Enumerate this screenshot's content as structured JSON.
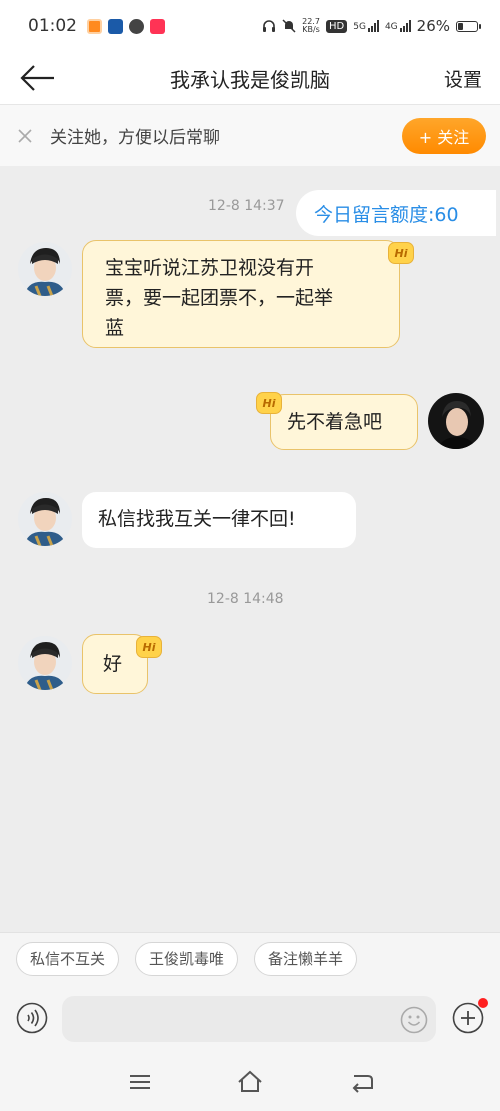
{
  "status_bar": {
    "time": "01:02",
    "net_speed_value": "22.7",
    "net_speed_unit": "KB/s",
    "hd_label": "HD",
    "signal_5g": "5G",
    "signal_4g": "4G",
    "battery_pct": "26%",
    "battery_level": 0.26,
    "icons": [
      "weibo-icon",
      "calendar-icon",
      "link-icon",
      "camera-app-icon",
      "headphones-icon",
      "mute-bell-icon",
      "signal-icon",
      "battery-icon"
    ]
  },
  "header": {
    "title": "我承认我是俊凯脑",
    "settings_label": "设置"
  },
  "follow_bar": {
    "text": "关注她，方便以后常聊",
    "button_label": "+ 关注"
  },
  "chat": {
    "quota_label": "今日留言额度:60",
    "messages": [
      {
        "type": "time",
        "text": "12-8 14:37"
      },
      {
        "type": "msg",
        "side": "left",
        "style": "yellow",
        "hi": true,
        "text": "宝宝听说江苏卫视没有开票，要一起团票不，一起举蓝"
      },
      {
        "type": "msg",
        "side": "right",
        "style": "yellow",
        "hi": true,
        "text": "先不着急吧"
      },
      {
        "type": "msg",
        "side": "left",
        "style": "white",
        "hi": false,
        "text": "私信找我互关一律不回!"
      },
      {
        "type": "time",
        "text": "12-8 14:48"
      },
      {
        "type": "msg",
        "side": "left",
        "style": "yellow",
        "hi": true,
        "text": "好"
      }
    ],
    "line1": "宝宝听说江苏卫视没有开",
    "line2": "票，要一起团票不，一起举",
    "line3": "蓝"
  },
  "hi_badge": "Hi",
  "quick_tags": [
    "私信不互关",
    "王俊凯毒唯",
    "备注懒羊羊"
  ],
  "input": {
    "placeholder": "",
    "value": ""
  },
  "colors": {
    "accent_orange": "#ff8a00",
    "quota_blue": "#2a8ee6",
    "bubble_yellow": "#fff6d9",
    "background": "#ededed"
  }
}
